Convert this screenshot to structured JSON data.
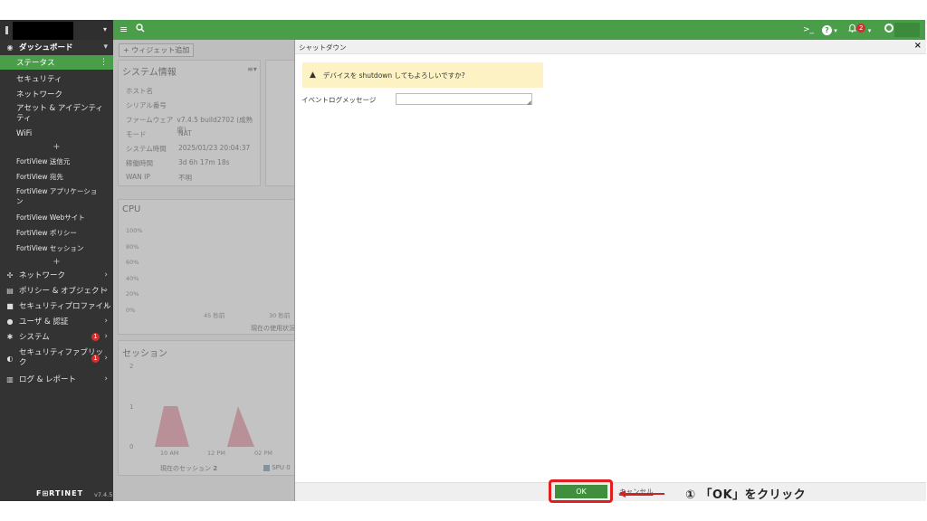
{
  "topbar": {
    "menu_icon": "≡",
    "search_icon": "⌕",
    "cli_icon": ">_",
    "help_icon": "?",
    "bell_badge": "2",
    "user_icon": "●",
    "colors": {
      "bar": "#4a9e4a"
    }
  },
  "sidebar": {
    "dashboard_label": "ダッシュボード",
    "items": [
      {
        "label": "ステータス"
      },
      {
        "label": "セキュリティ"
      },
      {
        "label": "ネットワーク"
      },
      {
        "label": "アセット & アイデンティ\nティ"
      },
      {
        "label": "WiFi"
      }
    ],
    "fortiview": [
      {
        "label": "FortiView 送信元"
      },
      {
        "label": "FortiView 宛先"
      },
      {
        "label": "FortiView アプリケーショ\nン"
      },
      {
        "label": "FortiView Webサイト"
      },
      {
        "label": "FortiView ポリシー"
      },
      {
        "label": "FortiView セッション"
      }
    ],
    "sections": [
      {
        "label": "ネットワーク"
      },
      {
        "label": "ポリシー & オブジェクト"
      },
      {
        "label": "セキュリティプロファイル"
      },
      {
        "label": "ユーザ & 認証"
      },
      {
        "label": "システム",
        "badge": "1"
      },
      {
        "label": "セキュリティファブリッ\nク",
        "badge": "1"
      },
      {
        "label": "ログ & レポート"
      }
    ],
    "plus": "+",
    "footer_brand": "F⊞RTINET",
    "version": "v7.4.5"
  },
  "dashboard": {
    "add_widget": "+ ウィジェット追加",
    "sysinfo_title": "システム情報",
    "info_rows": [
      {
        "k": "ホスト名",
        "v": ""
      },
      {
        "k": "シリアル番号",
        "v": ""
      },
      {
        "k": "ファームウェア",
        "v": "v7.4.5 build2702 (成熟度)"
      },
      {
        "k": "モード",
        "v": "NAT"
      },
      {
        "k": "システム時間",
        "v": "2025/01/23 20:04:37"
      },
      {
        "k": "稼働時間",
        "v": "3d 6h 17m 18s"
      },
      {
        "k": "WAN IP",
        "v": "不明"
      }
    ],
    "cpu_title": "CPU",
    "cpu_ticks": [
      "100%",
      "80%",
      "60%",
      "40%",
      "20%",
      "0%"
    ],
    "cpu_x_ticks": [
      "45 秒前",
      "30 秒前"
    ],
    "cpu_current": "現在の使用状況",
    "session_title": "セッション",
    "session_ticks": [
      "2",
      "1",
      "0"
    ],
    "session_x_ticks": [
      "10 AM",
      "12 PM",
      "02 PM"
    ],
    "session_current_label": "現在のセッション",
    "session_current_value": "2",
    "spu_label": "SPU",
    "spu_value": "0"
  },
  "dialog": {
    "title": "シャットダウン",
    "warning": "デバイスを shutdown してもよろしいですか?",
    "event_label": "イベントログメッセージ",
    "event_value": "",
    "ok": "OK",
    "cancel": "キャンセル",
    "colors": {
      "ok": "#3f8f3f",
      "warning_bg": "#fcf2c4"
    }
  },
  "annotation": {
    "text": "① 「OK」をクリック",
    "color": "#e02020"
  }
}
